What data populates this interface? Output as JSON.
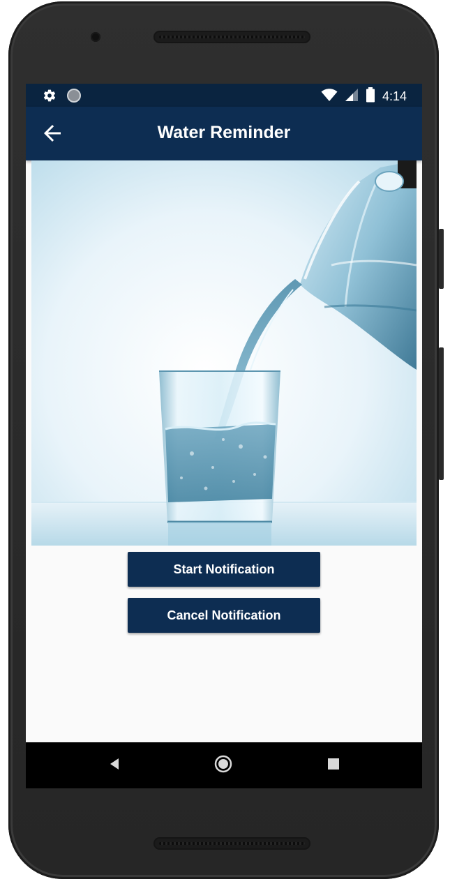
{
  "status_bar": {
    "time": "4:14",
    "icons": [
      "settings-icon",
      "circle-icon",
      "wifi-icon",
      "signal-icon",
      "battery-icon"
    ]
  },
  "app_bar": {
    "title": "Water Reminder",
    "back_icon": "arrow-left-icon"
  },
  "hero_image": {
    "subject": "water-pouring-into-glass"
  },
  "buttons": {
    "start_label": "Start Notification",
    "cancel_label": "Cancel Notification"
  },
  "nav_bar": {
    "icons": [
      "back-triangle-icon",
      "home-circle-icon",
      "recents-square-icon"
    ]
  },
  "colors": {
    "primary": "#0d2d52",
    "primary_dark": "#0a2440",
    "background": "#fafafa"
  }
}
